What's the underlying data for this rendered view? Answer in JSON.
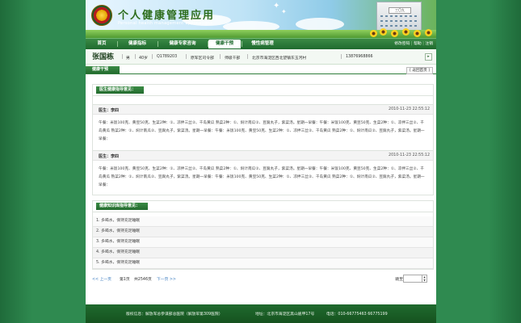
{
  "header": {
    "title": "个人健康管理应用",
    "subtitle": "Personal health management applications",
    "building_sign": "三〇九"
  },
  "nav": {
    "tabs": [
      {
        "label": "首页"
      },
      {
        "label": "健康指标"
      },
      {
        "label": "健康专家咨询"
      },
      {
        "label": "健康干预"
      },
      {
        "label": "慢性病管理"
      }
    ],
    "active_tab": "健康干预",
    "links": {
      "change_password": "修改密码",
      "help": "帮助",
      "logout": "注销"
    }
  },
  "patient": {
    "name": "张国栋",
    "gender": "男",
    "age": "40岁",
    "id": "Q1789203",
    "org": "原军区司令部",
    "role": "师级干部",
    "address": "北京市海淀区西北望镇东玉河村",
    "phone": "13876968866"
  },
  "section": {
    "title": "健康干预",
    "back": "[ 返回首页 ]"
  },
  "doctor_advice": {
    "title": "医生健康指导意见：",
    "records": [
      {
        "doctor": "医生：李四",
        "time": "2010-11-23 22:55:12",
        "text": "午餐：米饭100克、黄豆50克、生菜2种：①、凉拌三丝②、千岛黄瓜 熟菜2种：①、焖计南瓜②、豆腐丸子，紫菜汤。星期一早餐：午餐：米饭100克、黄豆50克、生菜2种：①、凉拌三丝②、千岛黄瓜 熟菜2种：①、焖计南瓜②、豆腐丸子，紫菜汤。星期一早餐：午餐：米饭100克、黄豆50克、生菜2种：①、凉拌三丝②、千岛黄瓜 熟菜2种：①、焖计南瓜②、豆腐丸子，紫菜汤。星期一早餐："
      },
      {
        "doctor": "医生：李四",
        "time": "2010-11-23 22:55:12",
        "text": "午餐：米饭100克、黄豆50克、生菜2种：①、凉拌三丝②、千岛黄瓜 熟菜2种：①、焖计南瓜②、豆腐丸子，紫菜汤。星期一早餐：午餐：米饭100克、黄豆50克、生菜2种：①、凉拌三丝②、千岛黄瓜 熟菜2种：①、焖计南瓜②、豆腐丸子，紫菜汤。星期一早餐：午餐：米饭100克、黄豆50克、生菜2种：①、凉拌三丝②、千岛黄瓜 熟菜2种：①、焖计南瓜②、豆腐丸子，紫菜汤。星期一早餐："
      }
    ]
  },
  "knowledge": {
    "title": "健康知识库指导意见：",
    "items": [
      "1. 多喝水，保持充足睡眠",
      "2. 多喝水，保持充足睡眠",
      "3. 多喝水，保持充足睡眠",
      "4. 多喝水，保持充足睡眠",
      "5. 多喝水，保持充足睡眠"
    ]
  },
  "pager": {
    "prev": "<< 上一页",
    "current": "第1页",
    "total": "共2546页",
    "next": "下一页 >>",
    "jump_label": "跳至"
  },
  "footer": {
    "host": "版权信息：解放军总参谋部总医院（解放军第309医院）",
    "address": "地址：北京市海淀区黑山扈甲17号",
    "tel": "电话：010-66775463 66775199"
  }
}
